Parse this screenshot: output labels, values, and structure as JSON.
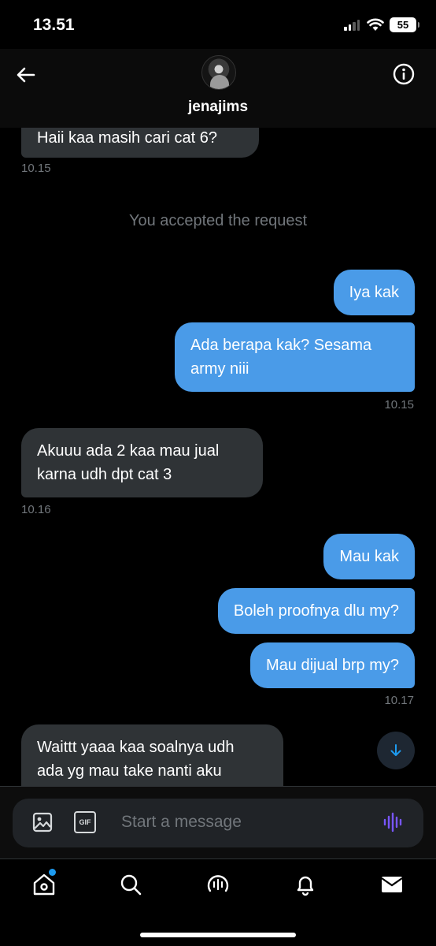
{
  "status_bar": {
    "time": "13.51",
    "battery": "55"
  },
  "header": {
    "contact_name": "jenajims"
  },
  "messages": {
    "m1": "Haii kaa masih cari cat 6?",
    "t1": "10.15",
    "system": "You accepted the request",
    "m2": "Iya kak",
    "m3_line1": "Ada berapa kak? Sesama",
    "m3_line2": "army niii",
    "t2": "10.15",
    "m4_line1": "Akuuu ada 2 kaa mau jual",
    "m4_line2": "karna udh dpt cat 3",
    "t3": "10.16",
    "m5": "Mau kak",
    "m6": "Boleh proofnya dlu my?",
    "m7": "Mau dijual brp my?",
    "t4": "10.17",
    "m8_line1": "Waittt yaaa kaa soalnya udh",
    "m8_line2": "ada yg mau take nanti aku"
  },
  "composer": {
    "placeholder": "Start a message",
    "gif_label": "GIF"
  },
  "icons": {
    "back": "arrow-left-icon",
    "info": "info-icon",
    "image": "image-icon",
    "gif": "gif-icon",
    "voice": "voice-wave-icon",
    "scroll": "arrow-down-icon",
    "nav": [
      "home-icon",
      "search-icon",
      "spaces-icon",
      "bell-icon",
      "mail-icon"
    ]
  },
  "colors": {
    "sent_bubble": "#4a9be8",
    "received_bubble": "#2f3336",
    "accent": "#1d9bf0",
    "voice": "#7856ff"
  }
}
